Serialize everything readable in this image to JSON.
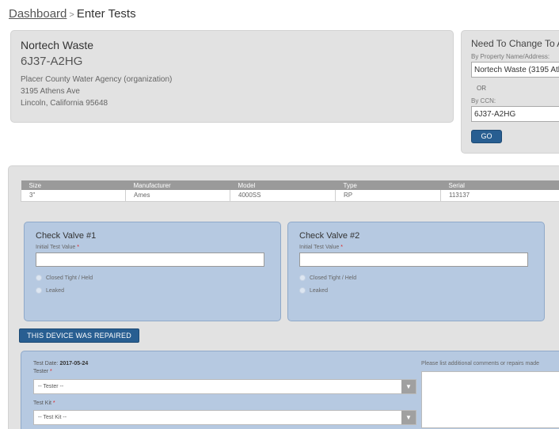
{
  "breadcrumb": {
    "parent": "Dashboard",
    "separator": ">",
    "current": "Enter Tests"
  },
  "organization": {
    "name": "Nortech Waste",
    "ccn": "6J37-A2HG",
    "agency": "Placer County Water Agency (organization)",
    "address1": "3195 Athens Ave",
    "address2": "Lincoln, California 95648"
  },
  "change": {
    "title": "Need To Change To A",
    "property_label": "By Property Name/Address:",
    "property_value": "Nortech Waste (3195 Ath",
    "or": "OR",
    "ccn_label": "By CCN:",
    "ccn_value": "6J37-A2HG",
    "go": "GO"
  },
  "device": {
    "headers": [
      "Size",
      "Manufacturer",
      "Model",
      "Type",
      "Serial"
    ],
    "row": [
      "3\"",
      "Ames",
      "4000SS",
      "RP",
      "113137"
    ]
  },
  "valves": [
    {
      "title": "Check Valve #1",
      "label": "Initial Test Value",
      "required": "*",
      "option1": "Closed Tight / Held",
      "option2": "Leaked",
      "value": ""
    },
    {
      "title": "Check Valve #2",
      "label": "Initial Test Value",
      "required": "*",
      "option1": "Closed Tight / Held",
      "option2": "Leaked",
      "value": ""
    }
  ],
  "repaired_button": "THIS DEVICE WAS REPAIRED",
  "details": {
    "test_date_label": "Test Date:",
    "test_date_value": "2017-05-24",
    "tester_label": "Tester",
    "tester_value": "-- Tester --",
    "testkit_label": "Test Kit",
    "testkit_value": "-- Test Kit --",
    "required": "*",
    "comments_label": "Please list additional comments or repairs made"
  },
  "colors": {
    "accent": "#285e91",
    "panel": "#e2e2e2",
    "valve_bg": "#b6c9e1",
    "required": "#dd2222"
  }
}
